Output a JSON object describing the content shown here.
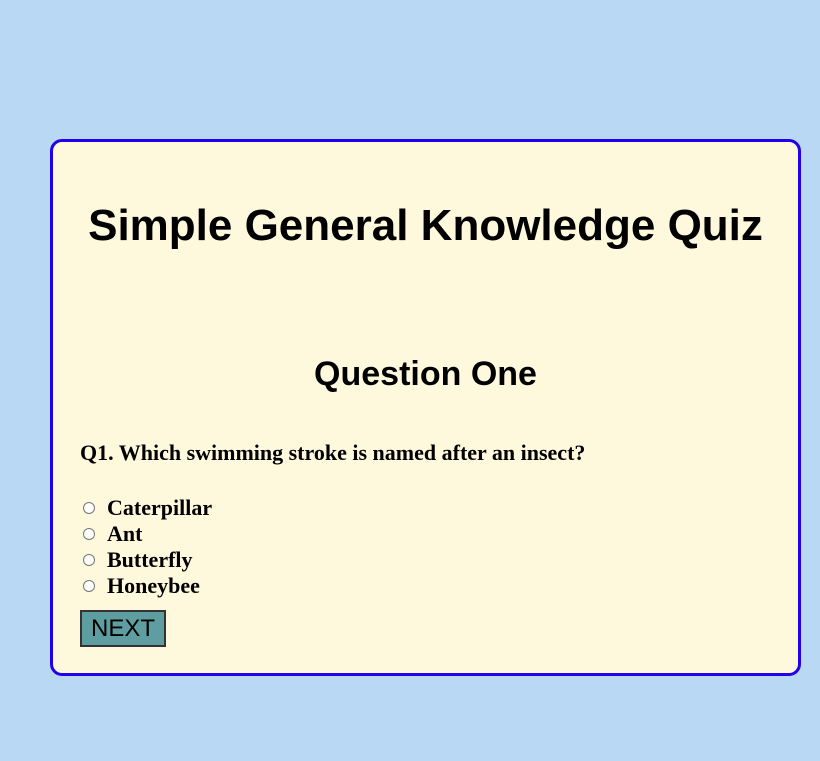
{
  "quiz": {
    "title": "Simple General Knowledge Quiz",
    "question_heading": "Question One",
    "question_text": "Q1. Which swimming stroke is named after an insect?",
    "options": [
      {
        "label": "Caterpillar",
        "selected": false
      },
      {
        "label": "Ant",
        "selected": false
      },
      {
        "label": "Butterfly",
        "selected": false
      },
      {
        "label": "Honeybee",
        "selected": false
      }
    ],
    "next_label": "NEXT"
  },
  "colors": {
    "page_background": "#b8d8f4",
    "card_background": "#fef8dc",
    "card_border": "#2200ee",
    "button_background": "#5f9ea0"
  },
  "icons": {
    "option_marker": "radio-button-icon"
  }
}
